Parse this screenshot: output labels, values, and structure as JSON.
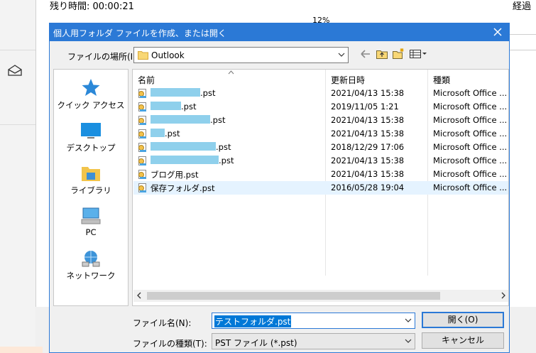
{
  "background": {
    "remaining_time": "残り時間: 00:00:21",
    "elapsed_label": "経過",
    "percent": "12%"
  },
  "dialog": {
    "title": "個人用フォルダ ファイルを作成、または開く",
    "location_label": "ファイルの場所(I):",
    "location_value": "Outlook",
    "places": [
      {
        "label": "クイック アクセス",
        "icon": "star-icon"
      },
      {
        "label": "デスクトップ",
        "icon": "desktop-icon"
      },
      {
        "label": "ライブラリ",
        "icon": "library-icon"
      },
      {
        "label": "PC",
        "icon": "pc-icon"
      },
      {
        "label": "ネットワーク",
        "icon": "network-icon"
      }
    ],
    "columns": [
      "名前",
      "更新日時",
      "種類"
    ],
    "files": [
      {
        "suffix": ".pst",
        "date": "2021/04/13 15:38",
        "type": "Microsoft Office ..."
      },
      {
        "suffix": ".pst",
        "date": "2019/11/05 1:21",
        "type": "Microsoft Office ..."
      },
      {
        "suffix": ".pst",
        "date": "2021/04/13 15:38",
        "type": "Microsoft Office ..."
      },
      {
        "suffix": ".pst",
        "date": "2021/04/13 15:38",
        "type": "Microsoft Office ..."
      },
      {
        "suffix": ".pst",
        "date": "2018/12/29 17:06",
        "type": "Microsoft Office ..."
      },
      {
        "suffix": ".pst",
        "date": "2021/04/13 15:38",
        "type": "Microsoft Office ..."
      },
      {
        "name": "ブログ用.pst",
        "date": "2021/04/13 15:38",
        "type": "Microsoft Office ..."
      },
      {
        "name": "保存フォルダ.pst",
        "date": "2016/05/28 19:04",
        "type": "Microsoft Office ..."
      }
    ],
    "filename_label": "ファイル名(N):",
    "filename_value": "テストフォルダ.pst",
    "filetype_label": "ファイルの種類(T):",
    "filetype_value": "PST ファイル (*.pst)",
    "open_button": "開く(O)",
    "cancel_button": "キャンセル"
  }
}
